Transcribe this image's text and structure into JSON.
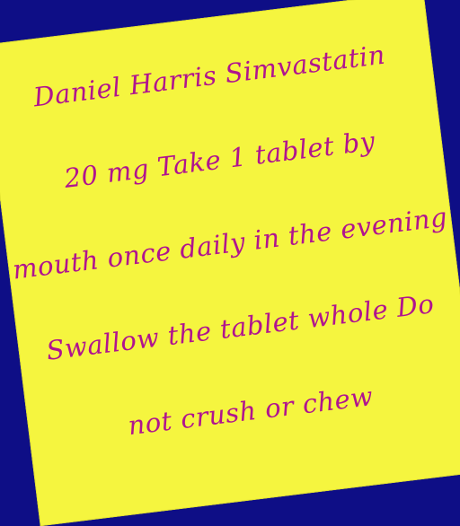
{
  "note": {
    "lines": [
      "Daniel Harris Simvastatin",
      "20 mg Take 1 tablet by",
      "mouth once daily in the evening",
      "Swallow the tablet whole Do",
      "not crush or chew"
    ]
  },
  "colors": {
    "background": "#0e0e86",
    "paper": "#f5f53f",
    "ink": "#b0148f"
  }
}
